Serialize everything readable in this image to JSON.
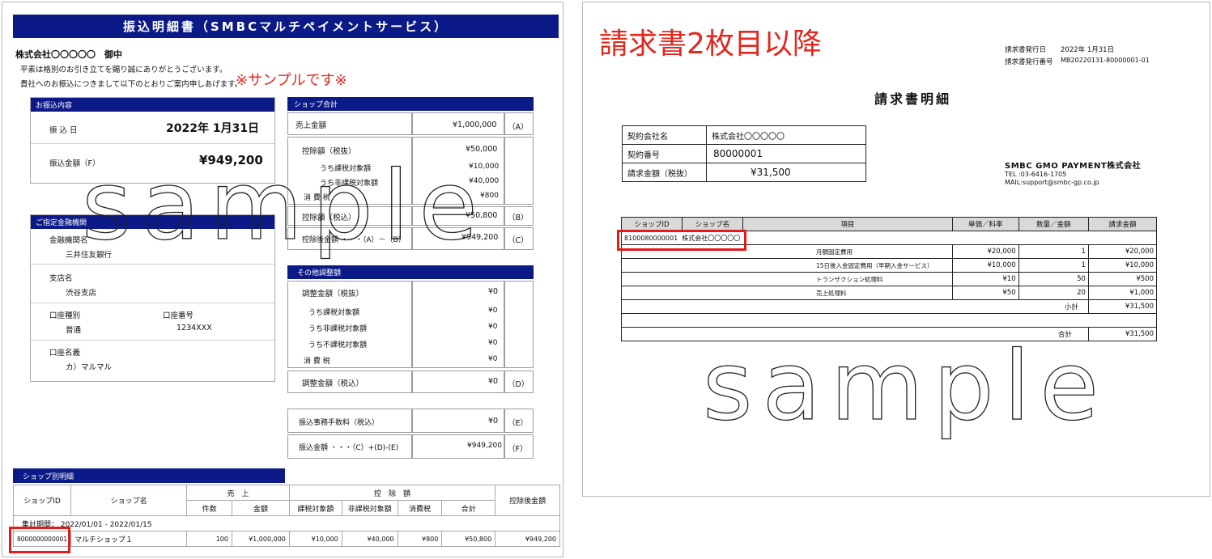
{
  "doc1": {
    "title": "振込明細書（SMBCマルチペイメントサービス）",
    "addressee": "株式会社〇〇〇〇〇　御中",
    "greeting_1": "平素は格別のお引き立てを賜り誠にありがとうございます。",
    "greeting_2": "貴社へのお振込につきまして以下のとおりご案内申しあげます。",
    "sample_note": "※サンプルです※",
    "transfer": {
      "head": "お振込内容",
      "date_label": "振 込 日",
      "date_value": "2022年 1月31日",
      "amount_label": "振込金額（F）",
      "amount_value": "¥949,200"
    },
    "bank": {
      "head": "ご指定金融機関",
      "bank_name_label": "金融機関名",
      "bank_name": "三井住友銀行",
      "branch_label": "支店名",
      "branch": "渋谷支店",
      "account_type_label": "口座種別",
      "account_type": "普通",
      "account_no_label": "口座番号",
      "account_no": "1234XXX",
      "account_name_label": "口座名義",
      "account_name": "カ）マルマル"
    },
    "shop_total": {
      "head": "ショップ合計",
      "sales_label": "売上金額",
      "sales_value": "¥1,000,000",
      "sales_tag": "（A）",
      "deduct_label": "控除額（税抜）",
      "deduct_value": "¥50,000",
      "taxable_label": "うち課税対象額",
      "taxable_value": "¥10,000",
      "nontaxable_label": "うち非課税対象額",
      "nontaxable_value": "¥40,000",
      "tax_label": "消 費 税",
      "tax_value": "¥800",
      "deduct_incl_label": "控除額（税込）",
      "deduct_incl_value": "¥50,800",
      "deduct_incl_tag": "（B）",
      "after_label": "控除後金額 ・・・（A）－（B）",
      "after_value": "¥949,200",
      "after_tag": "（C）"
    },
    "other": {
      "head": "その他調整額",
      "adj_label": "調整金額（税抜）",
      "adj_value": "¥0",
      "taxable_label": "うち課税対象額",
      "taxable_value": "¥0",
      "nontaxable_label": "うち非課税対象額",
      "nontaxable_value": "¥0",
      "untaxed_label": "うち不課税対象額",
      "untaxed_value": "¥0",
      "tax_label": "消 費 税",
      "tax_value": "¥0",
      "adj_incl_label": "調整金額（税込）",
      "adj_incl_value": "¥0",
      "adj_incl_tag": "（D）"
    },
    "fee": {
      "fee_label": "振込事務手数料（税込）",
      "fee_value": "¥0",
      "fee_tag": "（E）",
      "transfer_label": "振込金額 ・・・（C）+(D)-(E)",
      "transfer_value": "¥949,200",
      "transfer_tag": "（F）"
    },
    "shop_detail": {
      "head": "ショップ別明細",
      "col_shop_id": "ショップID",
      "col_shop_name": "ショップ名",
      "col_sales": "売　上",
      "col_count": "件数",
      "col_amount": "金額",
      "col_deduct": "控　除　額",
      "col_taxable": "課税対象額",
      "col_nontaxable": "非課税対象額",
      "col_tax": "消費税",
      "col_total": "合計",
      "col_after": "控除後金額",
      "period": "集計期間： 2022/01/01 - 2022/01/15",
      "row": {
        "shop_id": "8000000000001",
        "shop_name": "マルチショップ１",
        "count": "100",
        "amount": "¥1,000,000",
        "taxable": "¥10,000",
        "nontaxable": "¥40,000",
        "tax": "¥800",
        "total": "¥50,800",
        "after": "¥949,200"
      }
    },
    "watermark": "sample"
  },
  "doc2": {
    "heading": "請求書2枚目以降",
    "issue_date_label": "請求書発行日",
    "issue_date": "2022年 1月31日",
    "issue_no_label": "請求書発行番号",
    "issue_no": "MB20220131-80000001-01",
    "title": "請求書明細",
    "info": {
      "company_label": "契約会社名",
      "company": "株式会社〇〇〇〇〇",
      "contract_label": "契約番号",
      "contract": "80000001",
      "amount_label": "請求金額（税抜）",
      "amount": "¥31,500"
    },
    "issuer": {
      "name": "SMBC GMO PAYMENT株式会社",
      "tel": "TEL :03-6416-1705",
      "mail": "MAIL:support@smbc-gp.co.jp"
    },
    "table": {
      "h_shop_id": "ショップID",
      "h_shop_name": "ショップ名",
      "h_item": "項目",
      "h_unit": "単価／料率",
      "h_qty": "数量／金額",
      "h_amount": "請求金額",
      "shop_id": "8100080000001",
      "shop_name": "株式会社〇〇〇〇〇",
      "rows": [
        {
          "item": "月額固定費用",
          "unit": "¥20,000",
          "qty": "1",
          "amount": "¥20,000"
        },
        {
          "item": "15日後入金固定費用（早期入金サービス）",
          "unit": "¥10,000",
          "qty": "1",
          "amount": "¥10,000"
        },
        {
          "item": "トランザクション処理料",
          "unit": "¥10",
          "qty": "50",
          "amount": "¥500"
        },
        {
          "item": "売上処理料",
          "unit": "¥50",
          "qty": "20",
          "amount": "¥1,000"
        }
      ],
      "subtotal_label": "小計",
      "subtotal": "¥31,500",
      "total_label": "合計",
      "total": "¥31,500"
    },
    "watermark": "sample"
  },
  "colors": {
    "navy": "#0b1a86",
    "highlight_red": "#e31b1b",
    "header_gray": "#d9d9d9"
  }
}
